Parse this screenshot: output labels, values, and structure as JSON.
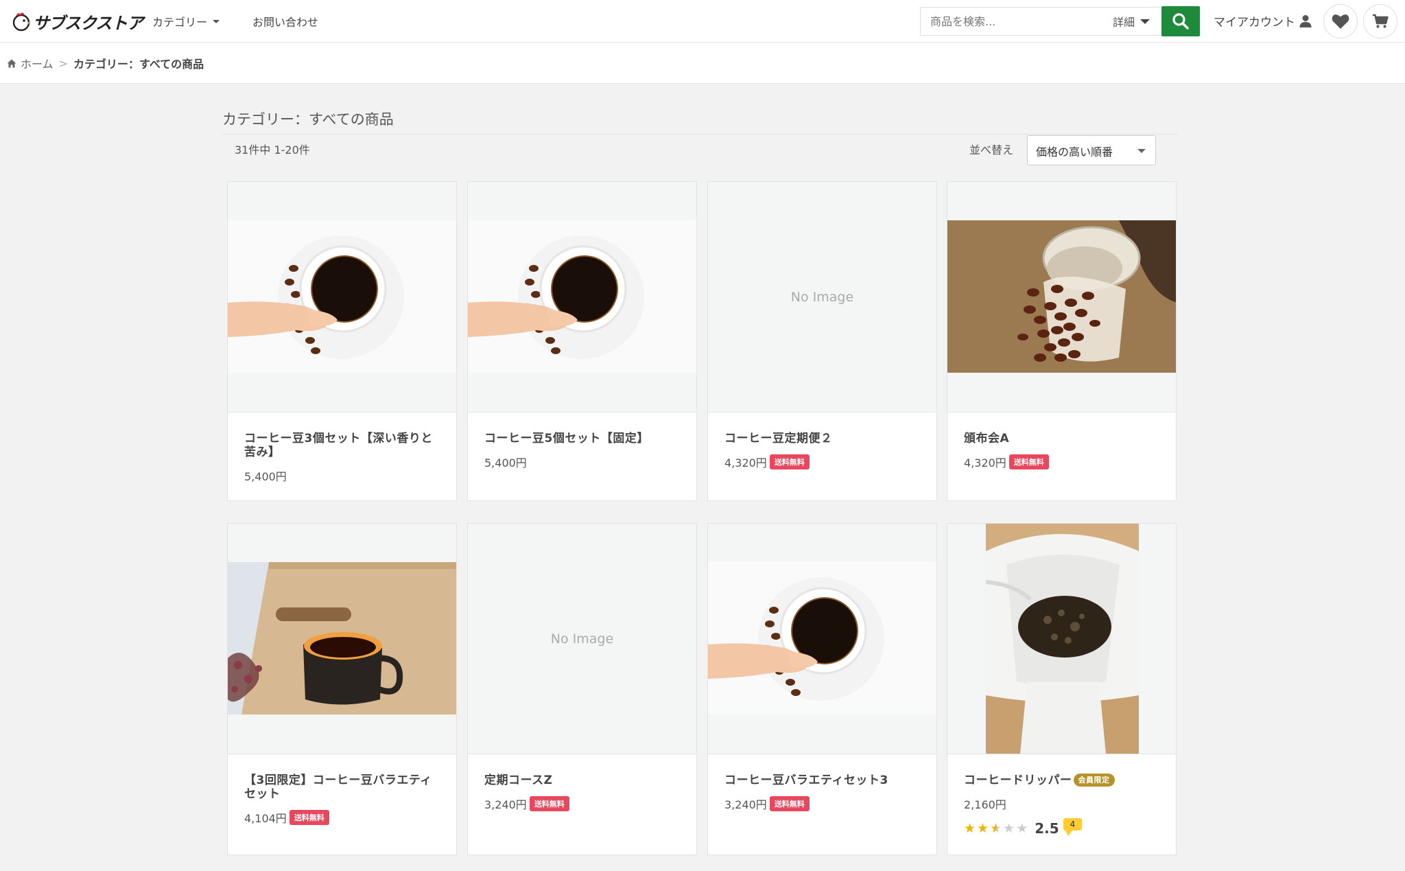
{
  "header": {
    "logo_text": "サブスクストア",
    "nav": {
      "category": "カテゴリー",
      "contact": "お問い合わせ"
    },
    "search": {
      "placeholder": "商品を検索...",
      "detail": "詳細"
    },
    "my_account": "マイアカウント"
  },
  "breadcrumb": {
    "home": "ホーム",
    "separator": ">",
    "current": "カテゴリー：すべての商品"
  },
  "main": {
    "title": "カテゴリー：すべての商品",
    "result_count": "31件中 1-20件",
    "sort_label": "並べ替え",
    "sort_value": "価格の高い順番"
  },
  "products": [
    {
      "name": "コーヒー豆3個セット【深い香りと苦み】",
      "price": "5,400円",
      "image": "coffee-cup-hand"
    },
    {
      "name": "コーヒー豆5個セット【固定】",
      "price": "5,400円",
      "image": "coffee-cup-hand"
    },
    {
      "name": "コーヒー豆定期便２",
      "price": "4,320円",
      "badge": "送料無料",
      "no_image": "No Image"
    },
    {
      "name": "頒布会A",
      "price": "4,320円",
      "badge": "送料無料",
      "image": "coffee-beans-spill"
    },
    {
      "name": "【3回限定】コーヒー豆バラエティセット",
      "price": "4,104円",
      "badge": "送料無料",
      "image": "coffee-cup-wood"
    },
    {
      "name": "定期コースZ",
      "price": "3,240円",
      "badge": "送料無料",
      "no_image": "No Image"
    },
    {
      "name": "コーヒー豆バラエティセット3",
      "price": "3,240円",
      "badge": "送料無料",
      "image": "coffee-cup-hand"
    },
    {
      "name": "コーヒードリッパー",
      "member_badge": "会員限定",
      "price": "2,160円",
      "image": "coffee-dripper",
      "rating": {
        "value": "2.5",
        "stars": 2.5,
        "reviews": "4"
      }
    }
  ],
  "colors": {
    "accent_green": "#1e8a3c",
    "free_shipping": "#e8475d",
    "member": "#b7922a",
    "star": "#f0b400"
  }
}
